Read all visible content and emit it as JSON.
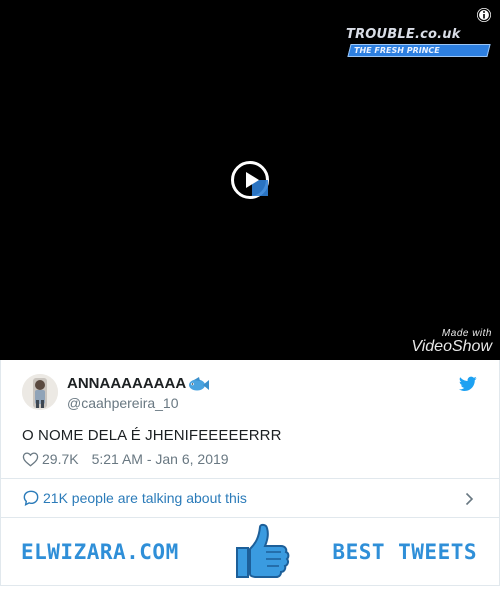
{
  "video": {
    "overlay_title": "TROUBLE.co.uk",
    "overlay_subtitle": "THE FRESH PRINCE",
    "watermark_top": "Made with",
    "watermark_brand": "VideoShow",
    "icons": [
      "info-icon",
      "play-icon"
    ]
  },
  "tweet": {
    "display_name": "ANNAAAAAAAA",
    "handle": "@caahpereira_10",
    "text": "O NOME DELA É JHENIFEEEEERRR",
    "likes": "29.7K",
    "timestamp": "5:21 AM - Jan 6, 2019",
    "icons": [
      "fish-emoji-icon",
      "twitter-bird-icon",
      "heart-icon"
    ]
  },
  "conversation": {
    "label": "21K people are talking about this",
    "icons": [
      "speech-bubble-icon",
      "chevron-right-icon"
    ]
  },
  "banner": {
    "left_text": "ELWIZARA.COM",
    "right_text": "BEST TWEETS",
    "icons": [
      "thumbs-up-icon"
    ]
  },
  "colors": {
    "link_blue": "#2b7bb9",
    "brand_blue": "#2f8fd8",
    "twitter_blue": "#1da1f2",
    "muted_gray": "#697882"
  }
}
